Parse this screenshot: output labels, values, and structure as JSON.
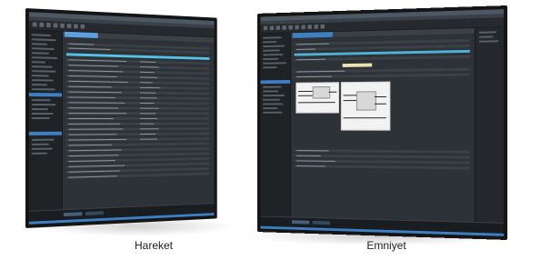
{
  "screens": {
    "left": {
      "caption": "Hareket"
    },
    "right": {
      "caption": "Emniyet"
    }
  },
  "colors": {
    "accent": "#55c2e8",
    "selection": "#3e7fc4",
    "ide_background": "#2b2f33",
    "bezel": "#151515"
  }
}
